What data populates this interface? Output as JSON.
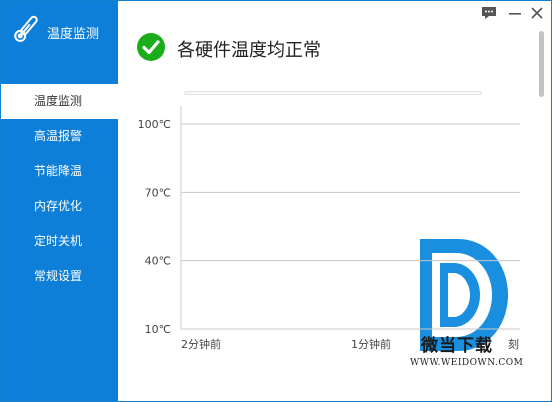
{
  "app": {
    "title": "温度监测"
  },
  "window_controls": {
    "chat": "chat-icon",
    "minimize": "minimize-icon",
    "close": "close-icon"
  },
  "sidebar": {
    "items": [
      {
        "label": "温度监测",
        "active": true
      },
      {
        "label": "高温报警",
        "active": false
      },
      {
        "label": "节能降温",
        "active": false
      },
      {
        "label": "内存优化",
        "active": false
      },
      {
        "label": "定时关机",
        "active": false
      },
      {
        "label": "常规设置",
        "active": false
      }
    ]
  },
  "status": {
    "text": "各硬件温度均正常",
    "icon": "check-circle-icon",
    "color": "#1aad19"
  },
  "colors": {
    "accent": "#0e7fd8",
    "grid": "#c8c8c8"
  },
  "chart_data": {
    "type": "line",
    "title": "",
    "ylabel": "",
    "xlabel": "",
    "y_ticks": [
      "100℃",
      "70℃",
      "40℃",
      "10℃"
    ],
    "y_values": [
      100,
      70,
      40,
      10
    ],
    "ylim": [
      10,
      100
    ],
    "x_ticks": [
      "2分钟前",
      "1分钟前",
      "刻"
    ],
    "series": [],
    "grid": true
  },
  "watermark": {
    "text": "微当下载",
    "url": "WWW.WEIDOWN.COM"
  }
}
